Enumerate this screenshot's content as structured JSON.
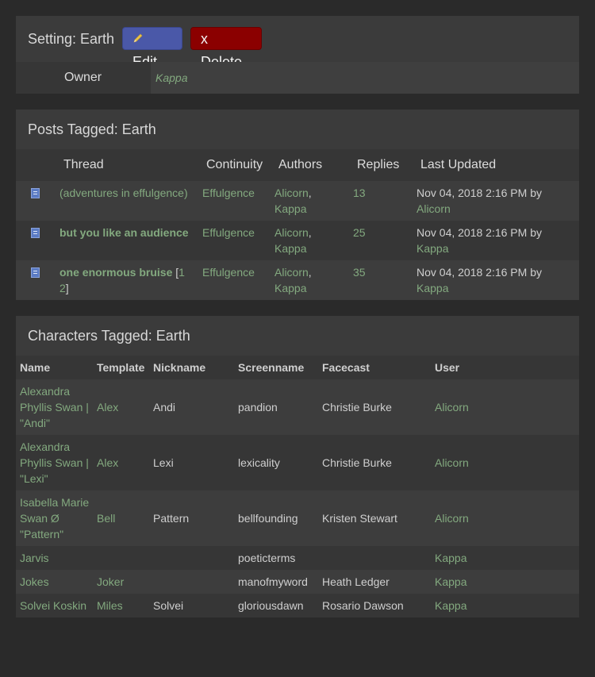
{
  "setting": {
    "title": "Setting: Earth",
    "edit_label": "Edit",
    "delete_label": "x Delete",
    "owner_label": "Owner",
    "owner_value": "Kappa"
  },
  "posts": {
    "title": "Posts Tagged: Earth",
    "columns": [
      "Thread",
      "Continuity",
      "Authors",
      "Replies",
      "Last Updated"
    ],
    "rows": [
      {
        "thread": "(adventures in effulgence)",
        "continuity": "Effulgence",
        "author1": "Alicorn",
        "author2": "Kappa",
        "replies": "13",
        "updated": "Nov 04, 2018 2:16 PM by",
        "by": "Alicorn"
      },
      {
        "thread": "but you like an audience",
        "continuity": "Effulgence",
        "author1": "Alicorn",
        "author2": "Kappa",
        "replies": "25",
        "updated": "Nov 04, 2018 2:16 PM by",
        "by": "Kappa"
      },
      {
        "thread": "one enormous bruise",
        "pages": [
          "1",
          "2"
        ],
        "continuity": "Effulgence",
        "author1": "Alicorn",
        "author2": "Kappa",
        "replies": "35",
        "updated": "Nov 04, 2018 2:16 PM by",
        "by": "Kappa"
      }
    ]
  },
  "characters": {
    "title": "Characters Tagged: Earth",
    "columns": [
      "Name",
      "Template",
      "Nickname",
      "Screenname",
      "Facecast",
      "User"
    ],
    "rows": [
      {
        "name": [
          "Alexandra",
          "Phyllis Swan |",
          "\"Andi\""
        ],
        "template": "Alex",
        "nickname": "Andi",
        "screenname": "pandion",
        "facecast": "Christie Burke",
        "user": "Alicorn"
      },
      {
        "name": [
          "Alexandra",
          "Phyllis Swan |",
          "\"Lexi\""
        ],
        "template": "Alex",
        "nickname": "Lexi",
        "screenname": "lexicality",
        "facecast": "Christie Burke",
        "user": "Alicorn"
      },
      {
        "name": [
          "Isabella Marie",
          "Swan Ø",
          "\"Pattern\""
        ],
        "template": "Bell",
        "nickname": "Pattern",
        "screenname": "bellfounding",
        "facecast": "Kristen Stewart",
        "user": "Alicorn"
      },
      {
        "name": [
          "Jarvis"
        ],
        "template": "",
        "nickname": "",
        "screenname": "poeticterms",
        "facecast": "",
        "user": "Kappa"
      },
      {
        "name": [
          "Jokes"
        ],
        "template": "Joker",
        "nickname": "",
        "screenname": "manofmyword",
        "facecast": "Heath Ledger",
        "user": "Kappa"
      },
      {
        "name": [
          "Solvei Koskin"
        ],
        "template": "Miles",
        "nickname": "Solvei",
        "screenname": "gloriousdawn",
        "facecast": "Rosario Dawson",
        "user": "Kappa"
      }
    ]
  }
}
